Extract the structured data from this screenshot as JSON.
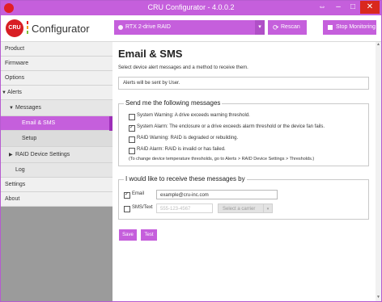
{
  "window": {
    "title": "CRU Configurator - 4.0.0.2"
  },
  "header": {
    "logo_text": "CRU",
    "app_name": "Configurator",
    "drive_selected": "RTX 2-drive RAID",
    "rescan_label": "Rescan",
    "stop_monitoring_label": "Stop Monitoring"
  },
  "sidebar": {
    "items": [
      {
        "label": "Product",
        "level": 0
      },
      {
        "label": "Firmware",
        "level": 0
      },
      {
        "label": "Options",
        "level": 0
      },
      {
        "label": "Alerts",
        "level": 0,
        "expanded": true
      },
      {
        "label": "Messages",
        "level": 1,
        "expanded": true
      },
      {
        "label": "Email & SMS",
        "level": 2,
        "active": true
      },
      {
        "label": "Setup",
        "level": 2
      },
      {
        "label": "RAID Device Settings",
        "level": 1,
        "collapsed": true
      },
      {
        "label": "Log",
        "level": 1
      },
      {
        "label": "Settings",
        "level": 0
      },
      {
        "label": "About",
        "level": 0
      }
    ]
  },
  "main": {
    "title": "Email & SMS",
    "subtitle": "Select device alert messages and a method to receive them.",
    "info": "Alerts will be sent by User.",
    "messages_group": {
      "title": "Send me the following messages",
      "options": [
        {
          "label": "System Warning: A drive exceeds warning threshold.",
          "checked": false
        },
        {
          "label": "System Alarm: The enclosure or a drive exceeds alarm threshold or the device fan fails.",
          "checked": true
        },
        {
          "label": "RAID Warning: RAID is degraded or rebuilding.",
          "checked": false
        },
        {
          "label": "RAID Alarm: RAID is invalid or has failed.",
          "checked": false
        }
      ],
      "note": "(To change device temperature thresholds, go to Alerts > RAID Device Settings > Thresholds.)"
    },
    "receive_group": {
      "title": "I would like to receive these messages by",
      "email": {
        "label": "Email",
        "checked": true,
        "value": "example@cru-inc.com"
      },
      "sms": {
        "label": "SMS/Text",
        "checked": false,
        "placeholder": "555-123-4567",
        "carrier_placeholder": "Select a carrier"
      }
    },
    "save_label": "Save",
    "test_label": "Test"
  },
  "colors": {
    "accent": "#c55fdc",
    "close": "#d9281e",
    "logo_red": "#d81e24"
  }
}
